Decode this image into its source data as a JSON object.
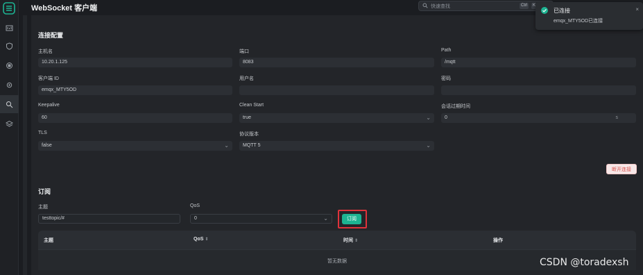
{
  "app": {
    "title": "WebSocket 客户端"
  },
  "search": {
    "placeholder": "快速查找",
    "kbd1": "Ctrl",
    "kbd2": "K"
  },
  "sidebar": {
    "icons": [
      "dashboard-icon",
      "shield-icon",
      "cluster-icon",
      "settings-icon",
      "diagnose-icon",
      "layers-icon"
    ],
    "active_index": 4
  },
  "connection": {
    "section_title": "连接配置",
    "host_label": "主机名",
    "host_value": "10.20.1.125",
    "port_label": "端口",
    "port_value": "8083",
    "path_label": "Path",
    "path_value": "/mqtt",
    "clientid_label": "客户端 ID",
    "clientid_value": "emqx_MTY5OD",
    "username_label": "用户名",
    "username_value": "",
    "password_label": "密码",
    "password_value": "",
    "keepalive_label": "Keepalive",
    "keepalive_value": "60",
    "cleanstart_label": "Clean Start",
    "cleanstart_value": "true",
    "expiry_label": "会话过期时间",
    "expiry_value": "0",
    "expiry_unit": "s",
    "tls_label": "TLS",
    "tls_value": "false",
    "protocol_label": "协议版本",
    "protocol_value": "MQTT 5",
    "disconnect_label": "断开连接"
  },
  "subscribe": {
    "section_title": "订阅",
    "topic_label": "主题",
    "topic_value": "testtopic/#",
    "qos_label": "QoS",
    "qos_value": "0",
    "button_label": "订阅",
    "columns": [
      "主题",
      "QoS",
      "时间",
      "操作"
    ],
    "empty_text": "暂无数据"
  },
  "toast": {
    "title": "已连接",
    "message": "emqx_MTY5OD已连接"
  },
  "watermark": "CSDN @toradexsh",
  "colors": {
    "accent": "#1db392",
    "danger": "#d9534f",
    "highlight": "#e0323b"
  }
}
